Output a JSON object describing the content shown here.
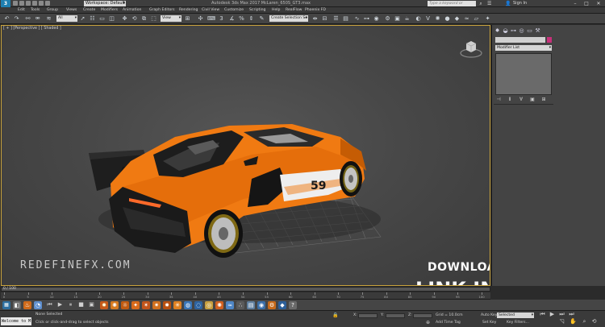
{
  "titlebar": {
    "workspace": "Workspace: Default",
    "file_title": "Autodesk 3ds Max 2017    McLaren_650S_GT3.max",
    "search_placeholder": "Type a keyword or phrase",
    "signin": "Sign In"
  },
  "menu": [
    "Edit",
    "Tools",
    "Group",
    "Views",
    "Create",
    "Modifiers",
    "Animation",
    "Graph Editors",
    "Rendering",
    "Civil View",
    "Customize",
    "Scripting",
    "Help",
    "RealFlow",
    "Phoenix FD"
  ],
  "toolbar": {
    "filter_select": "All",
    "view_select": "View",
    "named_selection": "Create Selection Se"
  },
  "viewport": {
    "label": "[ + ] [Perspective ] [ Shaded ]",
    "watermark": "REDEFINEFX.COM",
    "promo_line1": "DOWNLOAD THE PROJECT FILE",
    "promo_line2": "LINK IN DESCRIPTION",
    "car_number": "59"
  },
  "command_panel": {
    "modifier_list": "Modifier List"
  },
  "timeline": {
    "slider_label": "0 / 100",
    "ticks": [
      "0",
      "5",
      "10",
      "15",
      "20",
      "25",
      "30",
      "35",
      "40",
      "45",
      "50",
      "55",
      "60",
      "65",
      "70",
      "75",
      "80",
      "85",
      "90",
      "95",
      "100"
    ]
  },
  "statusbar": {
    "maxscript": "Welcome to M",
    "none_selected": "None Selected",
    "prompt": "Click or click-and-drag to select objects",
    "x_label": "X:",
    "y_label": "Y:",
    "z_label": "Z:",
    "grid": "Grid = 10.0cm",
    "add_time_tag": "Add Time Tag",
    "auto_key": "Auto Key",
    "selected": "Selected",
    "set_key": "Set Key",
    "key_filters": "Key Filters..."
  },
  "colors": {
    "car_orange": "#f07a12",
    "viewport_border": "#c8a23c",
    "accent_pink": "#c8307a"
  }
}
